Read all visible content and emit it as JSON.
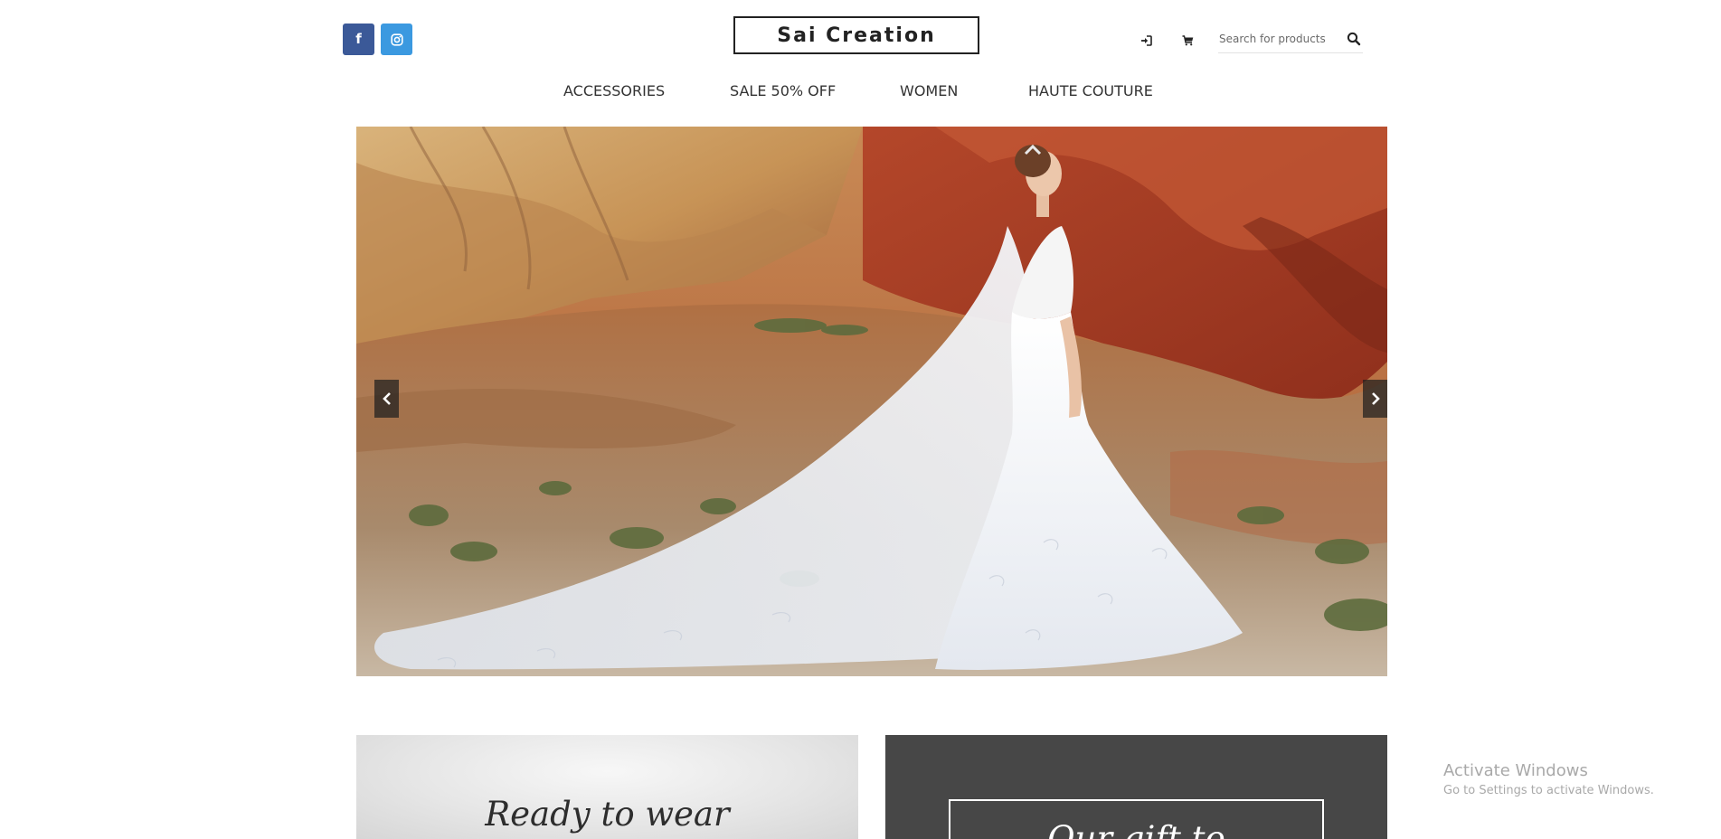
{
  "header": {
    "brand": "Sai Creation",
    "social": [
      {
        "name": "facebook",
        "glyph": "f",
        "color": "#3b5998"
      },
      {
        "name": "instagram",
        "glyph": "instagram-icon",
        "color": "#3b99e0"
      }
    ],
    "icons": [
      "login-icon",
      "cart-icon",
      "search-icon"
    ],
    "search": {
      "placeholder": "Search for products",
      "value": ""
    }
  },
  "nav": {
    "items": [
      {
        "label": "ACCESSORIES"
      },
      {
        "label": "SALE 50% OFF"
      },
      {
        "label": "WOMEN"
      },
      {
        "label": "HAUTE COUTURE"
      }
    ]
  },
  "hero": {
    "image": "bride-in-white-lace-gown-in-red-desert-hills",
    "controls": [
      "chevron-left-icon",
      "chevron-right-icon"
    ]
  },
  "promos": [
    {
      "title": "Ready to wear",
      "background": "#e6e6e6"
    },
    {
      "title": "Our gift to",
      "background": "#474747"
    }
  ],
  "watermark": {
    "title": "Activate Windows",
    "subtitle": "Go to Settings to activate Windows."
  },
  "colors": {
    "facebook": "#3b5998",
    "instagram": "#3b99e0",
    "dark_tile": "#474747",
    "text": "#333333"
  }
}
